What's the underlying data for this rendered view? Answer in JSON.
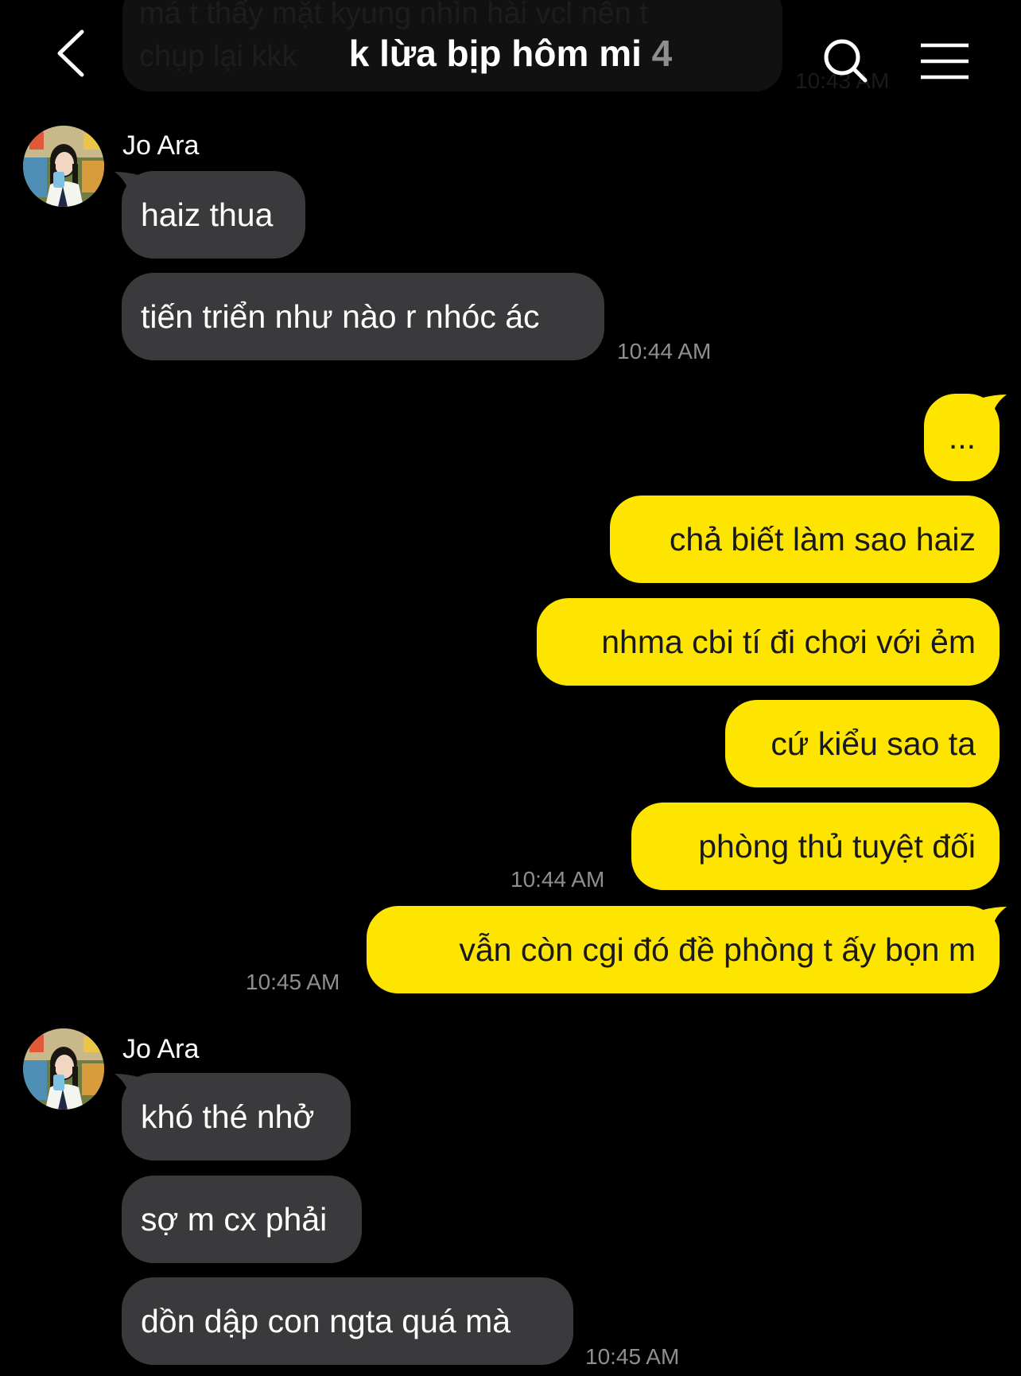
{
  "header": {
    "title": "k lừa bịp hôm mi",
    "member_count": "4",
    "back_icon": "chevron-left-icon",
    "search_icon": "search-icon",
    "menu_icon": "hamburger-menu-icon"
  },
  "previous_message": {
    "text": "má t thấy mặt kyung nhìn hài vcl nên t\nchụp lại kkk",
    "time": "10:43 AM"
  },
  "colors": {
    "background": "#000000",
    "incoming_bubble": "#3a3a3c",
    "outgoing_bubble": "#fee500",
    "timestamp": "#8e8e93"
  },
  "groups": [
    {
      "sender": "Jo Ara",
      "direction": "incoming",
      "messages": [
        "haiz thua",
        "tiến triển như nào r nhóc ác"
      ],
      "time": "10:44 AM"
    },
    {
      "direction": "outgoing",
      "messages": [
        "...",
        "chả biết làm sao haiz",
        "nhma cbi tí đi chơi với ẻm",
        "cứ kiểu sao ta",
        "phòng thủ tuyệt đối"
      ],
      "time": "10:44 AM"
    },
    {
      "direction": "outgoing",
      "messages": [
        "vẫn còn cgi đó đề phòng t ấy bọn m"
      ],
      "time": "10:45 AM"
    },
    {
      "sender": "Jo Ara",
      "direction": "incoming",
      "messages": [
        "khó thé nhở",
        "sợ m cx phải",
        "dồn dập con ngta quá mà"
      ],
      "time": "10:45 AM"
    }
  ]
}
